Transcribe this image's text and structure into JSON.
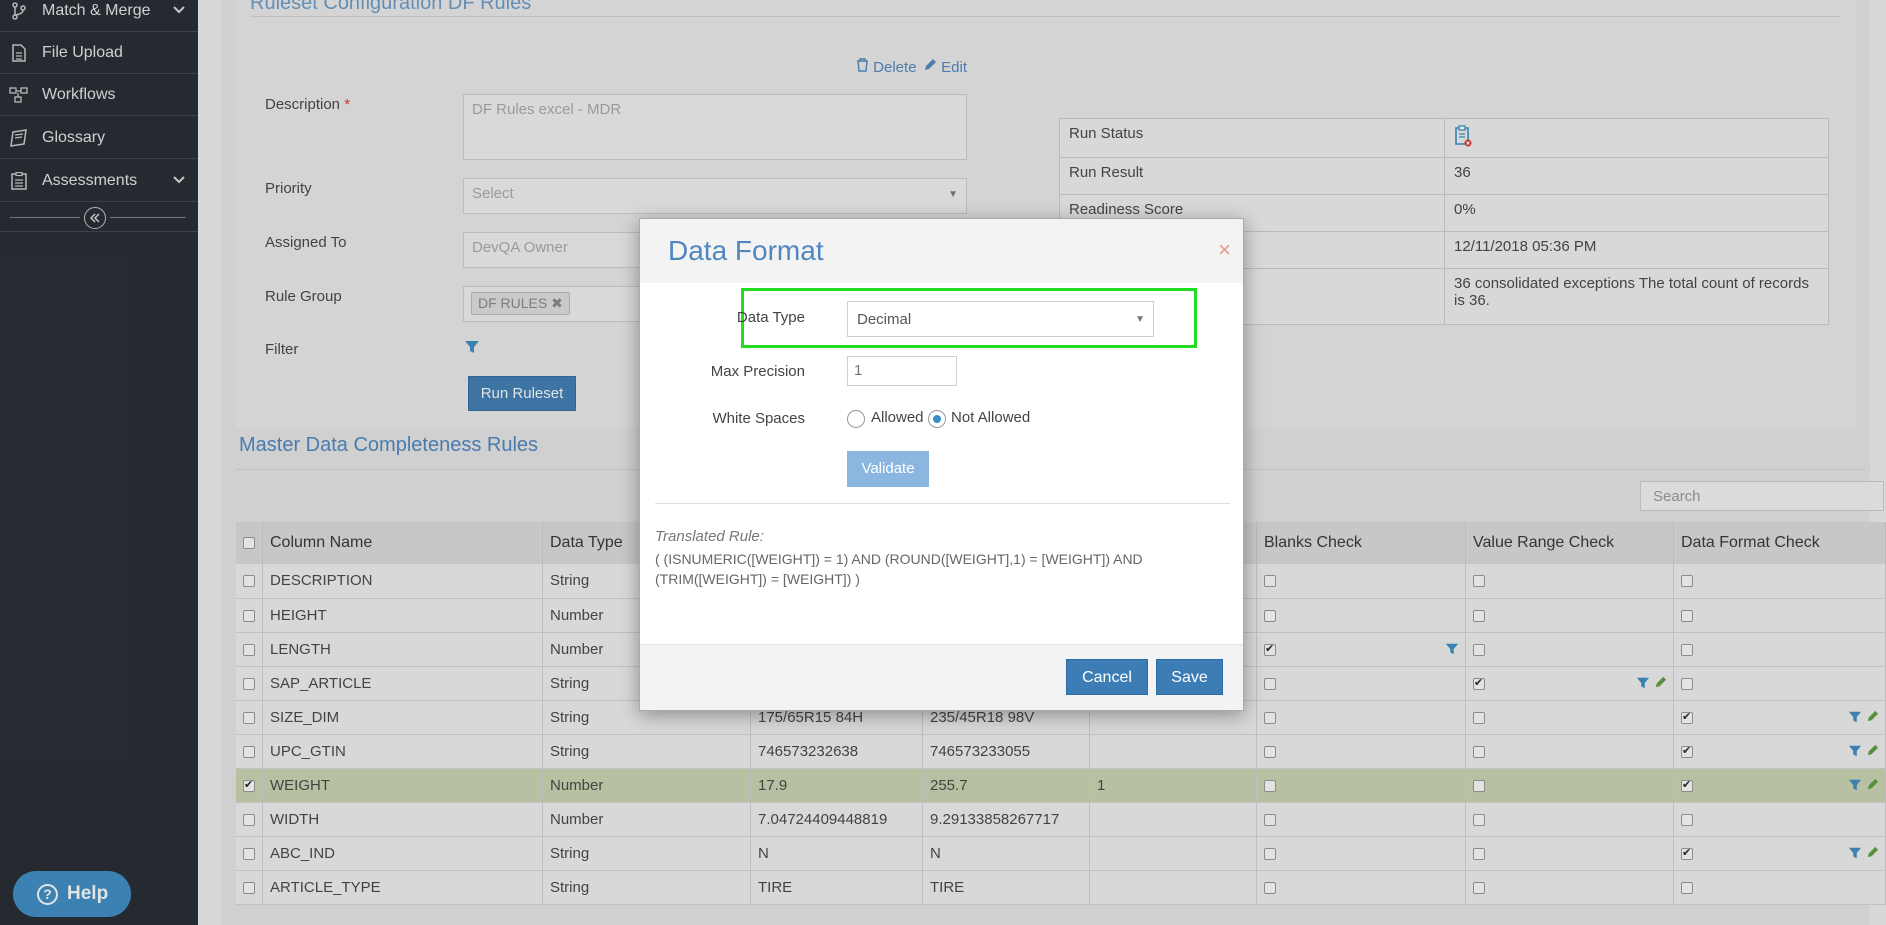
{
  "sidebar": {
    "items": [
      {
        "label": "Match & Merge",
        "icon": "merge-icon",
        "has_chevron": true
      },
      {
        "label": "File Upload",
        "icon": "file-icon",
        "has_chevron": false
      },
      {
        "label": "Workflows",
        "icon": "workflow-icon",
        "has_chevron": false
      },
      {
        "label": "Glossary",
        "icon": "glossary-icon",
        "has_chevron": false
      },
      {
        "label": "Assessments",
        "icon": "assessment-icon",
        "has_chevron": true
      }
    ],
    "help_label": "Help"
  },
  "config": {
    "section_title": "Ruleset Configuration DF Rules",
    "delete_label": "Delete",
    "edit_label": "Edit",
    "description_label": "Description",
    "description_value": "DF Rules excel - MDR",
    "priority_label": "Priority",
    "priority_value": "Select",
    "assigned_label": "Assigned To",
    "assigned_value": "DevQA Owner",
    "rule_group_label": "Rule Group",
    "rule_group_tag": "DF RULES",
    "filter_label": "Filter",
    "run_button": "Run Ruleset"
  },
  "status_table": [
    {
      "label": "Run Status",
      "value": ""
    },
    {
      "label": "Run Result",
      "value": "36"
    },
    {
      "label": "Readiness Score",
      "value": "0%"
    },
    {
      "label": "",
      "value": "12/11/2018 05:36 PM"
    },
    {
      "label": "",
      "value": "36 consolidated exceptions The total count of records is 36."
    }
  ],
  "grid": {
    "title": "Master Data Completeness Rules",
    "search_placeholder": "Search",
    "headers": [
      "Column Name",
      "Data Type",
      "",
      "",
      "",
      "Blanks Check",
      "Value Range Check",
      "Data Format Check"
    ],
    "rows": [
      {
        "name": "DESCRIPTION",
        "type": "String",
        "min": "",
        "max": "",
        "prec": "",
        "blank": false,
        "blank_icons": false,
        "range": false,
        "range_icons": false,
        "format": false,
        "format_icons": false,
        "selected": false
      },
      {
        "name": "HEIGHT",
        "type": "Number",
        "min": "",
        "max": "",
        "prec": "",
        "blank": false,
        "blank_icons": false,
        "range": false,
        "range_icons": false,
        "format": false,
        "format_icons": false,
        "selected": false
      },
      {
        "name": "LENGTH",
        "type": "Number",
        "min": "",
        "max": "",
        "prec": "",
        "blank": true,
        "blank_icons": true,
        "range": false,
        "range_icons": false,
        "format": false,
        "format_icons": false,
        "selected": false
      },
      {
        "name": "SAP_ARTICLE",
        "type": "String",
        "min": "",
        "max": "",
        "prec": "",
        "blank": false,
        "blank_icons": false,
        "range": true,
        "range_icons": true,
        "format": false,
        "format_icons": false,
        "selected": false
      },
      {
        "name": "SIZE_DIM",
        "type": "String",
        "min": "175/65R15 84H",
        "max": "235/45R18 98V",
        "prec": "",
        "blank": false,
        "blank_icons": false,
        "range": false,
        "range_icons": false,
        "format": true,
        "format_icons": true,
        "selected": false
      },
      {
        "name": "UPC_GTIN",
        "type": "String",
        "min": "746573232638",
        "max": "746573233055",
        "prec": "",
        "blank": false,
        "blank_icons": false,
        "range": false,
        "range_icons": false,
        "format": true,
        "format_icons": true,
        "selected": false
      },
      {
        "name": "WEIGHT",
        "type": "Number",
        "min": "17.9",
        "max": "255.7",
        "prec": "1",
        "blank": false,
        "blank_icons": false,
        "range": false,
        "range_icons": false,
        "format": true,
        "format_icons": true,
        "selected": true
      },
      {
        "name": "WIDTH",
        "type": "Number",
        "min": "7.04724409448819",
        "max": "9.29133858267717",
        "prec": "",
        "blank": false,
        "blank_icons": false,
        "range": false,
        "range_icons": false,
        "format": false,
        "format_icons": false,
        "selected": false
      },
      {
        "name": "ABC_IND",
        "type": "String",
        "min": "N",
        "max": "N",
        "prec": "",
        "blank": false,
        "blank_icons": false,
        "range": false,
        "range_icons": false,
        "format": true,
        "format_icons": true,
        "selected": false
      },
      {
        "name": "ARTICLE_TYPE",
        "type": "String",
        "min": "TIRE",
        "max": "TIRE",
        "prec": "",
        "blank": false,
        "blank_icons": false,
        "range": false,
        "range_icons": false,
        "format": false,
        "format_icons": false,
        "selected": false
      }
    ]
  },
  "modal": {
    "title": "Data Format",
    "data_type_label": "Data Type",
    "data_type_value": "Decimal",
    "max_precision_label": "Max Precision",
    "max_precision_value": "1",
    "white_spaces_label": "White Spaces",
    "allowed_label": "Allowed",
    "not_allowed_label": "Not Allowed",
    "white_spaces_selected": "Not Allowed",
    "validate_label": "Validate",
    "translated_title": "Translated Rule:",
    "translated_text": "( (ISNUMERIC([WEIGHT]) = 1) AND (ROUND([WEIGHT],1) = [WEIGHT]) AND (TRIM([WEIGHT]) = [WEIGHT]) )",
    "cancel_label": "Cancel",
    "save_label": "Save"
  },
  "colors": {
    "accent": "#3d7db6",
    "highlight": "#22dd22",
    "selected_row": "#ccd8b2",
    "sidebar": "#20262e"
  }
}
